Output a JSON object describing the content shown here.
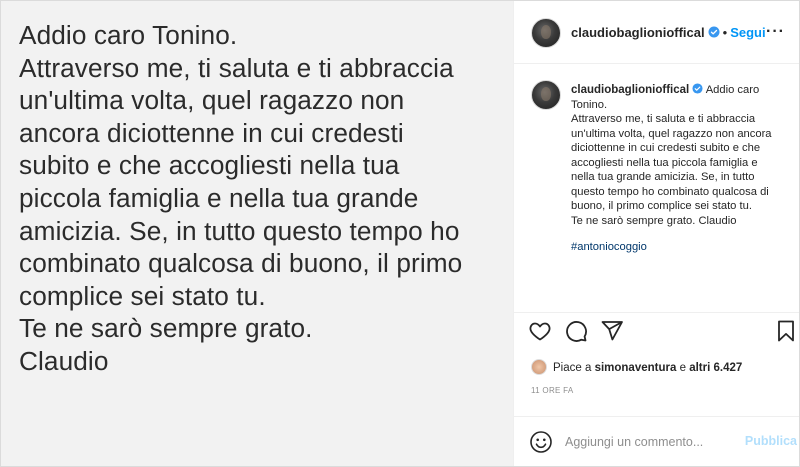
{
  "post_image": {
    "lines": [
      "Addio caro Tonino.",
      "Attraverso me, ti saluta e ti abbraccia",
      "un'ultima volta, quel ragazzo non",
      "ancora diciottenne in cui credesti",
      "subito e che accogliesti nella tua",
      "piccola famiglia e nella tua grande",
      "amicizia. Se, in tutto questo tempo ho",
      "combinato qualcosa di buono, il primo",
      "complice sei stato tu.",
      "Te ne sarò sempre grato.",
      "Claudio"
    ]
  },
  "header": {
    "username": "claudiobaglionioffical",
    "separator": "•",
    "follow_label": "Segui",
    "more_label": "···"
  },
  "caption": {
    "username": "claudiobaglionioffical",
    "first_line": "Addio caro",
    "lines": [
      "Tonino.",
      "Attraverso me, ti saluta e ti abbraccia",
      "un'ultima volta, quel ragazzo non ancora",
      "diciottenne in cui credesti subito e che",
      "accogliesti nella tua piccola famiglia e",
      "nella tua grande amicizia. Se, in tutto",
      "questo tempo ho combinato qualcosa di",
      "buono, il primo complice sei stato tu.",
      "Te ne sarò sempre grato. Claudio"
    ],
    "hashtag": "#antoniocoggio"
  },
  "likes": {
    "prefix": "Piace a",
    "user": "simonaventura",
    "middle": "e",
    "others": "altri 6.427"
  },
  "timestamp": "11 ORE FA",
  "comment": {
    "placeholder": "Aggiungi un commento...",
    "publish_label": "Pubblica"
  },
  "icons": [
    "heart-icon",
    "comment-icon",
    "share-icon",
    "bookmark-icon",
    "emoji-icon",
    "verified-icon",
    "more-icon"
  ],
  "colors": {
    "link_blue": "#0095f6",
    "hashtag": "#00376b",
    "muted": "#8e8e8e",
    "publish_disabled": "#b2dffc",
    "image_bg": "#f2f2f2"
  }
}
